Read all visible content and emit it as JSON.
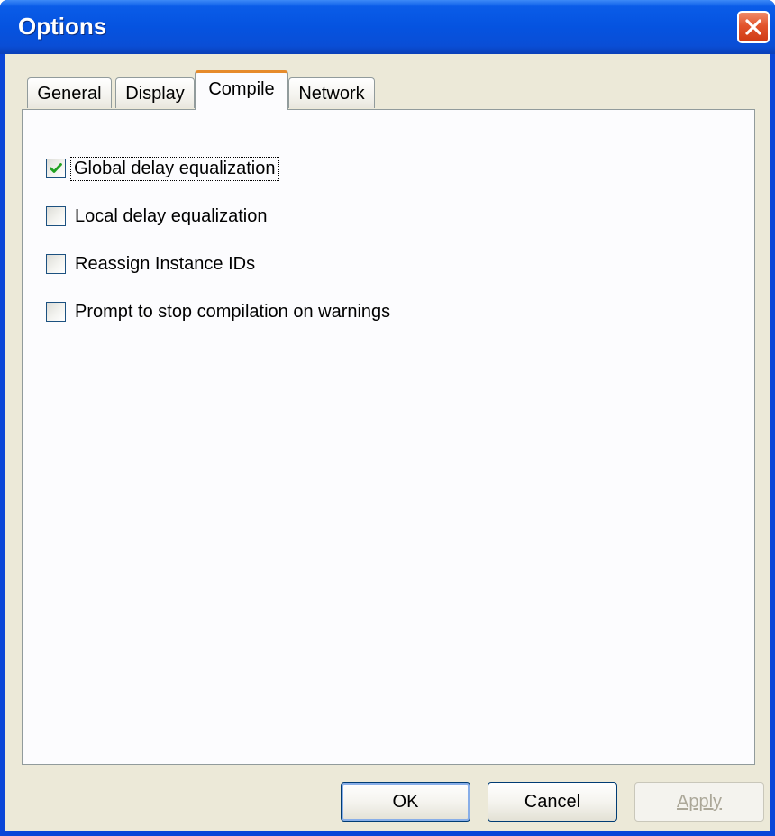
{
  "window": {
    "title": "Options",
    "close_icon": "close-icon"
  },
  "tabs": [
    {
      "label": "General",
      "active": false
    },
    {
      "label": "Display",
      "active": false
    },
    {
      "label": "Compile",
      "active": true
    },
    {
      "label": "Network",
      "active": false
    }
  ],
  "options": [
    {
      "label": "Global delay equalization",
      "checked": true
    },
    {
      "label": "Local delay equalization",
      "checked": false
    },
    {
      "label": "Reassign Instance IDs",
      "checked": false
    },
    {
      "label": "Prompt to stop compilation on warnings",
      "checked": false
    }
  ],
  "buttons": {
    "ok_label": "OK",
    "cancel_label": "Cancel",
    "apply_label": "Apply",
    "apply_enabled": false
  },
  "colors": {
    "titlebar": "#0553e0",
    "active_tab_highlight": "#e68b2c",
    "checkmark": "#21a121"
  }
}
